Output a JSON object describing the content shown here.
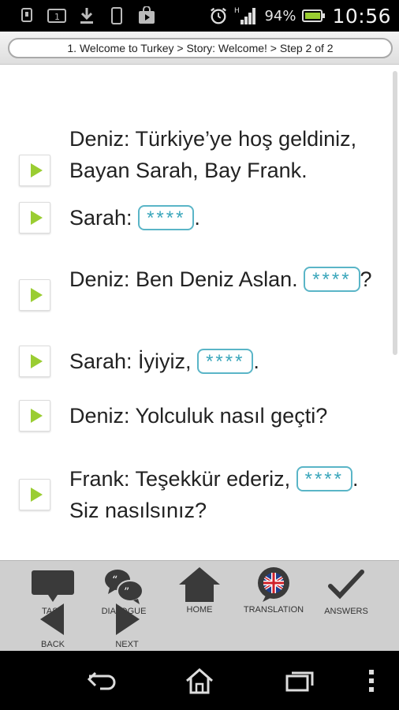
{
  "status_bar": {
    "battery_percent": "94%",
    "time": "10:56",
    "network_type": "H",
    "icons": [
      "usb-debug-icon",
      "sd-card-icon",
      "download-icon",
      "phone-icon",
      "store-icon",
      "alarm-icon",
      "signal-icon",
      "battery-icon"
    ]
  },
  "breadcrumb": "1.  Welcome to Turkey > Story: Welcome! > Step 2 of 2",
  "lines": [
    {
      "parts": [
        {
          "t": "Deniz: Türkiye’ye hoş geldiniz, Bayan Sarah, Bay Frank."
        }
      ]
    },
    {
      "parts": [
        {
          "t": "Sarah: "
        },
        {
          "blank": "****"
        },
        {
          "t": "."
        }
      ]
    },
    {
      "parts": [
        {
          "t": "Deniz: Ben Deniz Aslan. "
        },
        {
          "blank": "****"
        },
        {
          "t": "?"
        }
      ]
    },
    {
      "parts": [
        {
          "t": "Sarah: İyiyiz, "
        },
        {
          "blank": "****"
        },
        {
          "t": "."
        }
      ]
    },
    {
      "parts": [
        {
          "t": "Deniz: Yolculuk nasıl geçti?"
        }
      ]
    },
    {
      "parts": [
        {
          "t": "Frank: Teşekkür ederiz, "
        },
        {
          "blank": "****"
        },
        {
          "t": ". Siz nasılsınız?"
        }
      ]
    }
  ],
  "toolbar": {
    "task": "TASK",
    "dialogue": "DIALOGUE",
    "home": "HOME",
    "translation": "TRANSLATION",
    "answers": "ANSWERS",
    "back": "BACK",
    "next": "NEXT"
  },
  "colors": {
    "accent_green": "#9acd32",
    "blank_border": "#5ab5c7",
    "toolbar_bg": "#cfcfcf",
    "icon_dark": "#3a3a3a"
  }
}
